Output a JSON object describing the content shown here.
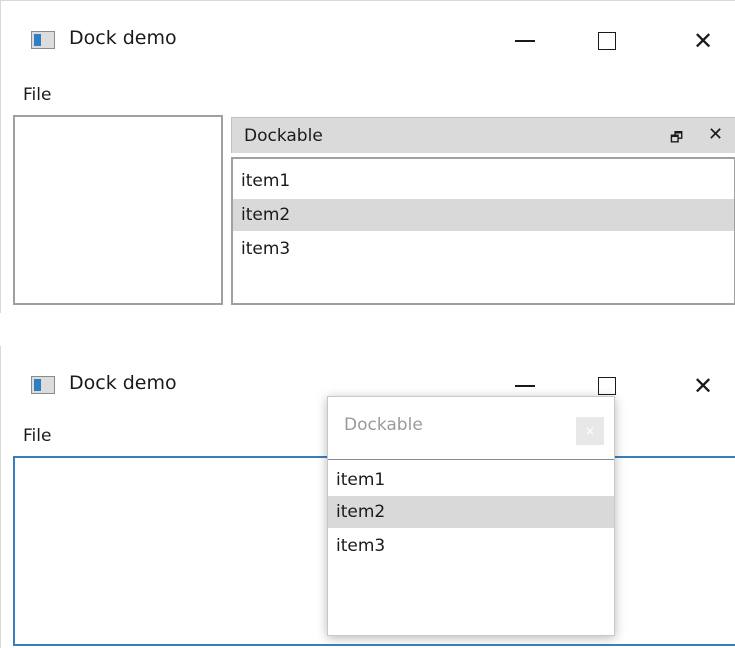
{
  "window1": {
    "title": "Dock demo",
    "menu": {
      "file": "File"
    },
    "controls": {
      "minimize": "minimize-icon",
      "maximize": "maximize-icon",
      "close": "close-icon"
    },
    "dockable": {
      "title": "Dockable",
      "restore_glyph": "🗗",
      "close_glyph": "✕",
      "items": [
        "item1",
        "item2",
        "item3"
      ],
      "selected": "item2"
    }
  },
  "window2": {
    "title": "Dock demo",
    "menu": {
      "file": "File"
    },
    "floating": {
      "title": "Dockable",
      "close_glyph": "×",
      "items": [
        "item1",
        "item2",
        "item3"
      ],
      "selected": "item2"
    }
  },
  "colors": {
    "selection": "#d9d9d9",
    "focus_border": "#3b7ec0",
    "header_bg": "#dadada"
  }
}
